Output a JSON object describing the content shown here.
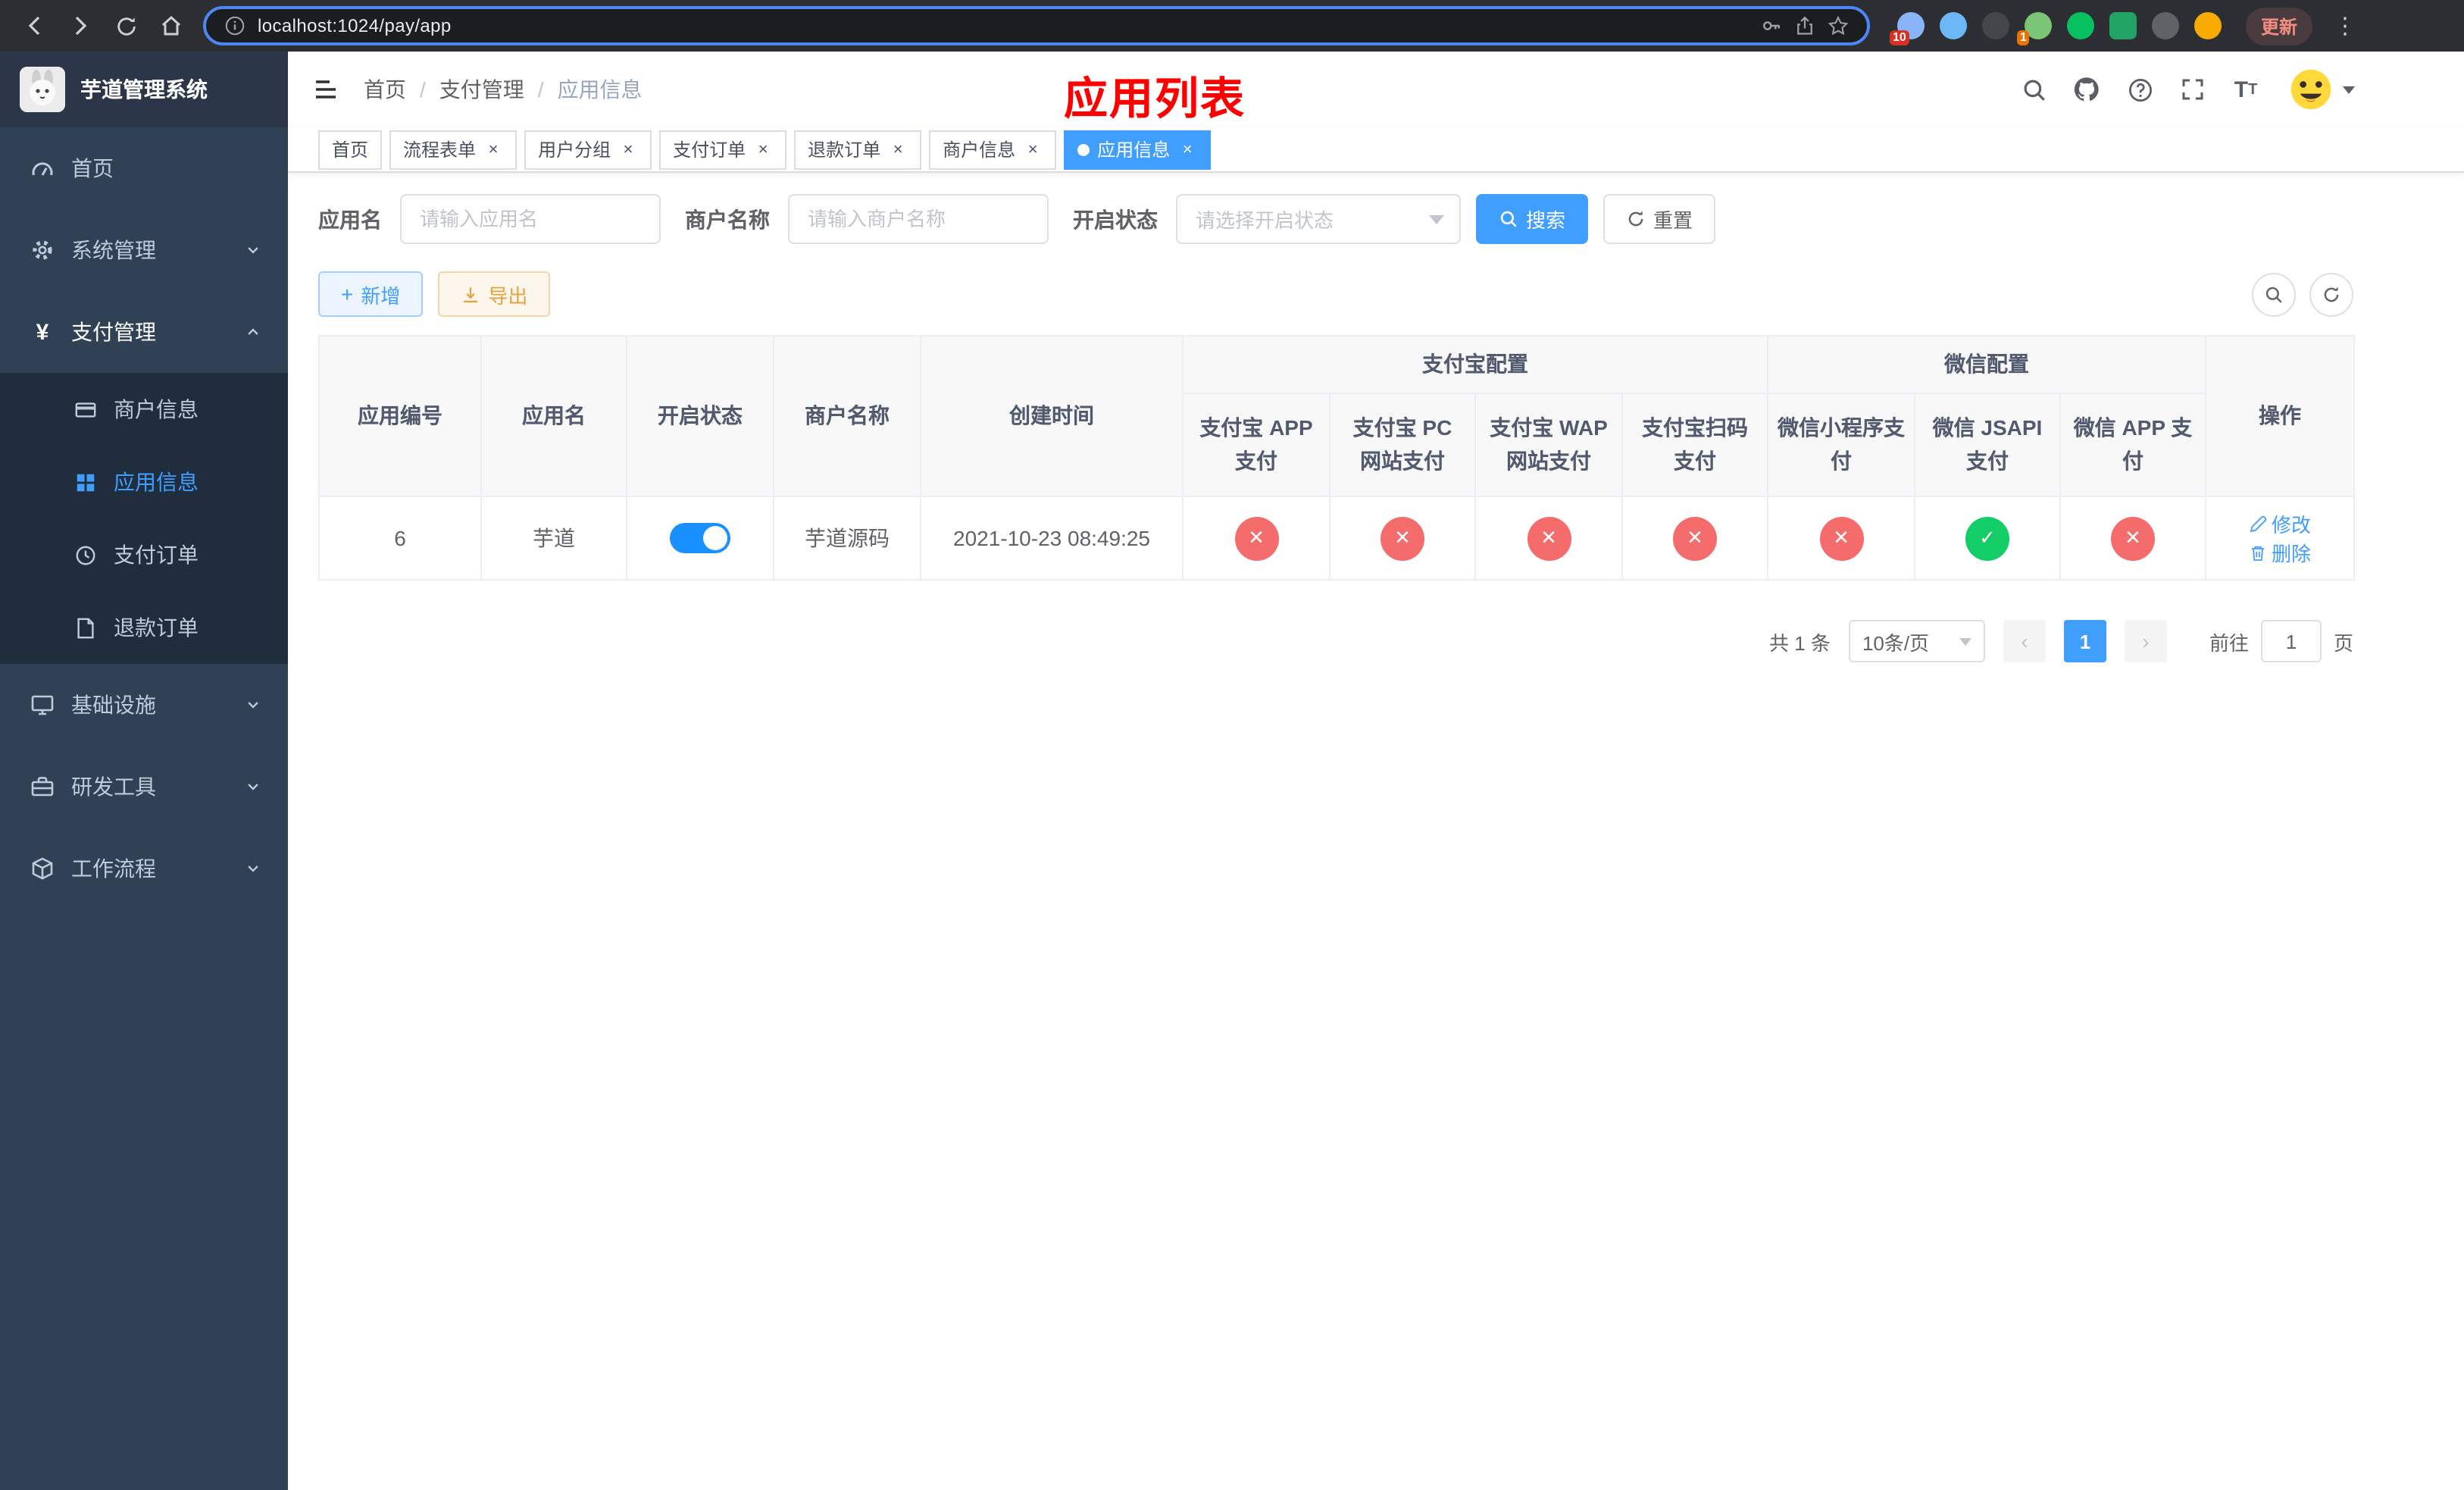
{
  "browser": {
    "url": "localhost:1024/pay/app",
    "update_label": "更新",
    "extensions": [
      {
        "name": "extensions-puzzle",
        "badge": "10"
      },
      {
        "name": "blue-drop-extension",
        "badge": ""
      },
      {
        "name": "dark-extension",
        "badge": ""
      },
      {
        "name": "green-leaf-extension",
        "badge": "1"
      },
      {
        "name": "wechat-extension",
        "badge": ""
      },
      {
        "name": "notes-extension",
        "badge": ""
      },
      {
        "name": "pin-extension",
        "badge": ""
      },
      {
        "name": "profile-extension",
        "badge": ""
      }
    ]
  },
  "sidebar": {
    "title": "芋道管理系统",
    "items": [
      {
        "label": "首页"
      },
      {
        "label": "系统管理"
      },
      {
        "label": "支付管理",
        "children": [
          {
            "label": "商户信息"
          },
          {
            "label": "应用信息"
          },
          {
            "label": "支付订单"
          },
          {
            "label": "退款订单"
          }
        ]
      },
      {
        "label": "基础设施"
      },
      {
        "label": "研发工具"
      },
      {
        "label": "工作流程"
      }
    ]
  },
  "header": {
    "breadcrumb": [
      "首页",
      "支付管理",
      "应用信息"
    ],
    "page_title": "应用列表"
  },
  "tabs": [
    {
      "label": "首页"
    },
    {
      "label": "流程表单"
    },
    {
      "label": "用户分组"
    },
    {
      "label": "支付订单"
    },
    {
      "label": "退款订单"
    },
    {
      "label": "商户信息"
    },
    {
      "label": "应用信息"
    }
  ],
  "filters": {
    "app_name_label": "应用名",
    "app_name_placeholder": "请输入应用名",
    "merchant_label": "商户名称",
    "merchant_placeholder": "请输入商户名称",
    "status_label": "开启状态",
    "status_placeholder": "请选择开启状态",
    "search_label": "搜索",
    "reset_label": "重置"
  },
  "toolbar": {
    "add_label": "新增",
    "export_label": "导出"
  },
  "table": {
    "columns": {
      "app_id": "应用编号",
      "app_name": "应用名",
      "status": "开启状态",
      "merchant": "商户名称",
      "created": "创建时间",
      "alipay_group": "支付宝配置",
      "wechat_group": "微信配置",
      "alipay_app": "支付宝 APP 支付",
      "alipay_pc": "支付宝 PC 网站支付",
      "alipay_wap": "支付宝 WAP 网站支付",
      "alipay_scan": "支付宝扫码支付",
      "wechat_lite": "微信小程序支付",
      "wechat_jsapi": "微信 JSAPI 支付",
      "wechat_app": "微信 APP 支付",
      "actions": "操作"
    },
    "rows": [
      {
        "app_id": "6",
        "app_name": "芋道",
        "enabled": true,
        "merchant": "芋道源码",
        "created": "2021-10-23 08:49:25",
        "alipay_app": false,
        "alipay_pc": false,
        "alipay_wap": false,
        "alipay_scan": false,
        "wechat_lite": false,
        "wechat_jsapi": true,
        "wechat_app": false,
        "edit_label": "修改",
        "delete_label": "删除"
      }
    ]
  },
  "pagination": {
    "total_label": "共 1 条",
    "page_size_label": "10条/页",
    "current_page": "1",
    "goto_label": "前往",
    "goto_value": "1",
    "goto_suffix": "页"
  },
  "colors": {
    "accent": "#409eff",
    "danger": "#f56c6c",
    "success": "#13ce66",
    "warning": "#e6a23c",
    "sidebar_bg": "#304156",
    "title_red": "#ff0000"
  }
}
